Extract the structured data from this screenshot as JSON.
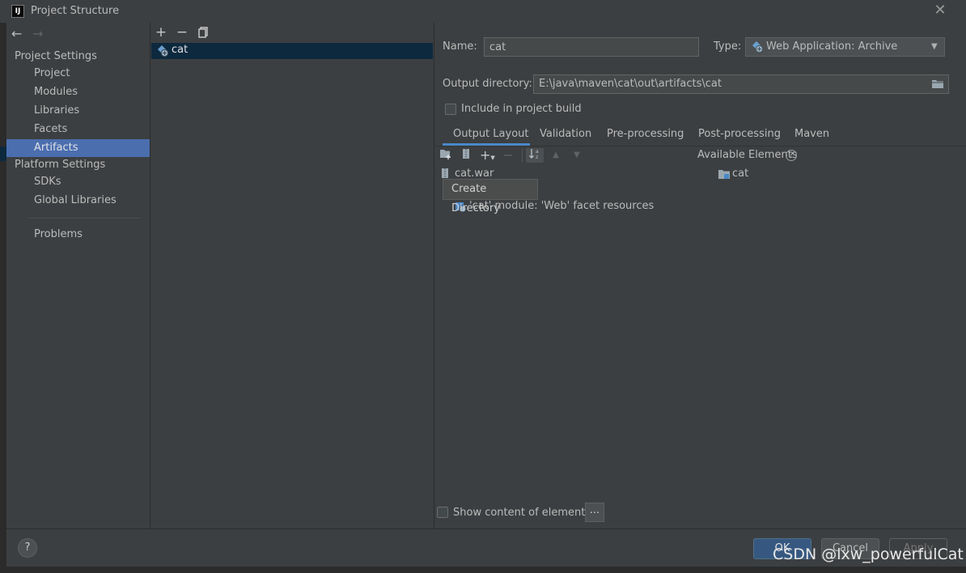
{
  "window": {
    "title": "Project Structure",
    "app_icon": "IJ"
  },
  "sidebar": {
    "sections": [
      {
        "label": "Project Settings",
        "items": [
          "Project",
          "Modules",
          "Libraries",
          "Facets",
          "Artifacts"
        ]
      },
      {
        "label": "Platform Settings",
        "items": [
          "SDKs",
          "Global Libraries"
        ]
      }
    ],
    "problems": "Problems",
    "selected": "Artifacts"
  },
  "artifact_list": {
    "toolbar": [
      "add-icon",
      "remove-icon",
      "copy-icon"
    ],
    "items": [
      {
        "name": "cat",
        "icon": "web-archive-icon",
        "selected": true
      }
    ]
  },
  "form": {
    "name_label": "Name:",
    "name_value": "cat",
    "type_label": "Type:",
    "type_value": "Web Application: Archive",
    "output_label": "Output directory:",
    "output_value": "E:\\java\\maven\\cat\\out\\artifacts\\cat",
    "include_build_label": "Include in project build",
    "include_build_checked": false
  },
  "tabs": [
    {
      "label": "Output Layout",
      "active": true
    },
    {
      "label": "Validation"
    },
    {
      "label": "Pre-processing"
    },
    {
      "label": "Post-processing"
    },
    {
      "label": "Maven"
    }
  ],
  "layout_toolbar": [
    "create-directory-icon",
    "archive-icon",
    "add-icon",
    "remove-icon",
    "sort-icon",
    "move-up-icon",
    "move-down-icon"
  ],
  "tree": {
    "root": "cat.war",
    "children": [
      "'cat' module: 'Web' facet resources"
    ]
  },
  "tooltip": "Create Directory",
  "available": {
    "label": "Available Elements",
    "items": [
      "cat"
    ]
  },
  "show_content_label": "Show content of elements",
  "ellipsis_label": "...",
  "buttons": {
    "help": "?",
    "ok": "OK",
    "cancel": "Cancel",
    "apply": "Apply"
  },
  "watermark": "CSDN @lxw_powerfulCat",
  "colors": {
    "accent": "#4b6eaf",
    "selection": "#0d293e",
    "tab_underline": "#4a88c7",
    "background": "#3c3f41"
  }
}
